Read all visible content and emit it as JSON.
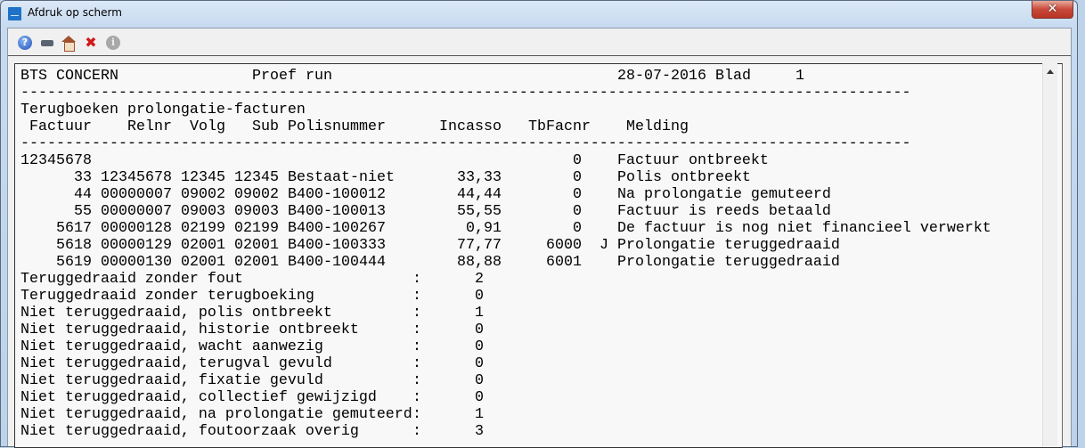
{
  "window": {
    "title": "Afdruk op scherm",
    "close_glyph": "✕"
  },
  "toolbar": {
    "help": "?",
    "close": "✖",
    "info": "i"
  },
  "report": {
    "company": "BTS CONCERN",
    "run": "Proef run",
    "date": "28-07-2016",
    "page_label": "Blad",
    "page": "1",
    "separator": "----------------------------------------------------------------------------------------------------",
    "section_title": "Terugboeken prolongatie-facturen",
    "columns": [
      "Factuur",
      "Relnr",
      "Volg",
      "Sub",
      "Polisnummer",
      "Incasso",
      "TbFacnr",
      "Melding"
    ],
    "rows": [
      {
        "factuur": "12345678",
        "relnr": "",
        "volg": "",
        "sub": "",
        "polis": "",
        "incasso": "",
        "tbfacnr": "0",
        "flag": "",
        "melding": "Factuur ontbreekt"
      },
      {
        "factuur": "33",
        "relnr": "12345678",
        "volg": "12345",
        "sub": "12345",
        "polis": "Bestaat-niet",
        "incasso": "33,33",
        "tbfacnr": "0",
        "flag": "",
        "melding": "Polis ontbreekt"
      },
      {
        "factuur": "44",
        "relnr": "00000007",
        "volg": "09002",
        "sub": "09002",
        "polis": "B400-100012",
        "incasso": "44,44",
        "tbfacnr": "0",
        "flag": "",
        "melding": "Na prolongatie gemuteerd"
      },
      {
        "factuur": "55",
        "relnr": "00000007",
        "volg": "09003",
        "sub": "09003",
        "polis": "B400-100013",
        "incasso": "55,55",
        "tbfacnr": "0",
        "flag": "",
        "melding": "Factuur is reeds betaald"
      },
      {
        "factuur": "5617",
        "relnr": "00000128",
        "volg": "02199",
        "sub": "02199",
        "polis": "B400-100267",
        "incasso": "0,91",
        "tbfacnr": "0",
        "flag": "",
        "melding": "De factuur is nog niet financieel verwerkt"
      },
      {
        "factuur": "5618",
        "relnr": "00000129",
        "volg": "02001",
        "sub": "02001",
        "polis": "B400-100333",
        "incasso": "77,77",
        "tbfacnr": "6000",
        "flag": "J",
        "melding": "Prolongatie teruggedraaid"
      },
      {
        "factuur": "5619",
        "relnr": "00000130",
        "volg": "02001",
        "sub": "02001",
        "polis": "B400-100444",
        "incasso": "88,88",
        "tbfacnr": "6001",
        "flag": "",
        "melding": "Prolongatie teruggedraaid"
      }
    ],
    "summary": [
      {
        "label": "Teruggedraaid zonder fout",
        "value": "2"
      },
      {
        "label": "Teruggedraaid zonder terugboeking",
        "value": "0"
      },
      {
        "label": "Niet teruggedraaid, polis ontbreekt",
        "value": "1"
      },
      {
        "label": "Niet teruggedraaid, historie ontbreekt",
        "value": "0"
      },
      {
        "label": "Niet teruggedraaid, wacht aanwezig",
        "value": "0"
      },
      {
        "label": "Niet teruggedraaid, terugval gevuld",
        "value": "0"
      },
      {
        "label": "Niet teruggedraaid, fixatie gevuld",
        "value": "0"
      },
      {
        "label": "Niet teruggedraaid, collectief gewijzigd",
        "value": "0"
      },
      {
        "label": "Niet teruggedraaid, na prolongatie gemuteerd",
        "value": "1"
      },
      {
        "label": "Niet teruggedraaid, foutoorzaak overig",
        "value": "3"
      }
    ],
    "colon": ":"
  }
}
